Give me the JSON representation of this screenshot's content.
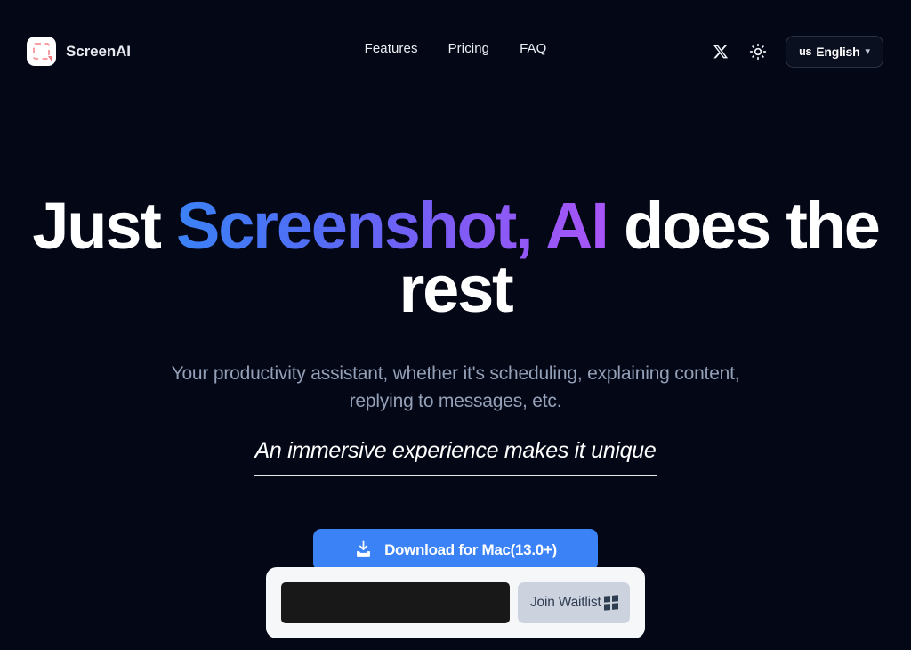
{
  "theme": {
    "background": "#040816",
    "accent_blue": "#3b82f6",
    "accent_purple": "#a855f7",
    "logo_red": "#f1787e",
    "card_background": "#f6f7f9",
    "waitlist_button": "#ccd2de"
  },
  "header": {
    "brand": {
      "name": "ScreenAI",
      "logo_icon": "screenshot-marquee-icon"
    },
    "nav": [
      {
        "label": "Features"
      },
      {
        "label": "Pricing"
      },
      {
        "label": "FAQ"
      }
    ],
    "actions": {
      "twitter_icon": "x-twitter-icon",
      "theme_toggle_icon": "sun-icon",
      "language": {
        "code": "us",
        "label": "English",
        "chevron": "chevron-down-icon"
      }
    }
  },
  "hero": {
    "headline": {
      "part_plain_start": "Just ",
      "part_gradient": "Screenshot, AI",
      "part_plain_end": " does the rest",
      "full_text": "Just Screenshot, AI does the rest"
    },
    "subtitle": "Your productivity assistant, whether it's scheduling, explaining content, replying to messages, etc.",
    "tagline": "An immersive experience makes it unique",
    "download_button": {
      "label": "Download for Mac(13.0+)",
      "icon": "download-icon"
    }
  },
  "waitlist": {
    "input_value": "",
    "input_placeholder": "",
    "button_label": "Join Waitlist",
    "button_icon": "windows-icon"
  }
}
